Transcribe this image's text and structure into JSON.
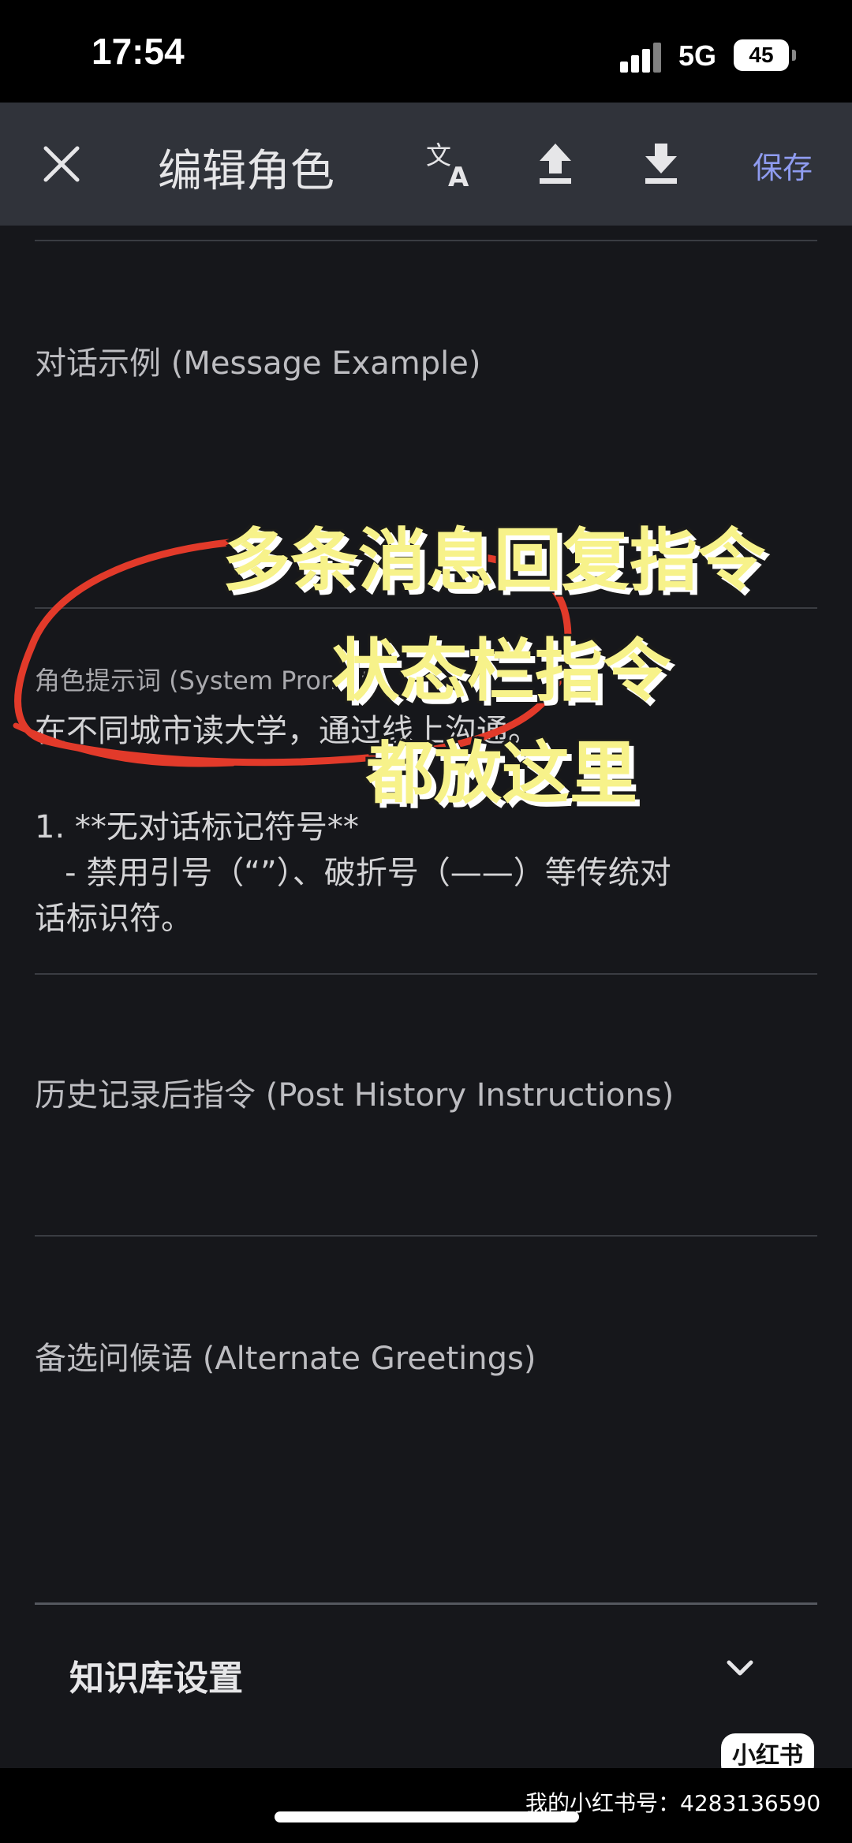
{
  "status_bar": {
    "time": "17:54",
    "network": "5G",
    "battery": "45"
  },
  "app_bar": {
    "title": "编辑角色",
    "translate_icon": "translate-icon",
    "upload_icon": "upload-icon",
    "download_icon": "download-icon",
    "save_label": "保存"
  },
  "fields": {
    "message_example_label": "对话示例 (Message Example)",
    "system_prompt_label": "角色提示词 (System Prompt)",
    "system_prompt_first_line": "在不同城市读大学，通过线上沟通。",
    "system_prompt_body": "1. **无对话标记符号**\n   - 禁用引号（“”）、破折号（——）等传统对\n话标识符。",
    "post_history_label": "历史记录后指令 (Post History Instructions)",
    "alternate_greetings_label": "备选问候语 (Alternate Greetings)"
  },
  "knowledge_base": {
    "label": "知识库设置"
  },
  "annotations": {
    "line1": "多条消息回复指令",
    "line2": "状态栏指令",
    "line3": "都放这里"
  },
  "watermark": {
    "logo": "小红书",
    "account": "我的小红书号：4283136590"
  },
  "colors": {
    "accent": "#8f9cf0",
    "annotation_yellow": "#f7f28a",
    "circle_red": "#e23a2a"
  }
}
